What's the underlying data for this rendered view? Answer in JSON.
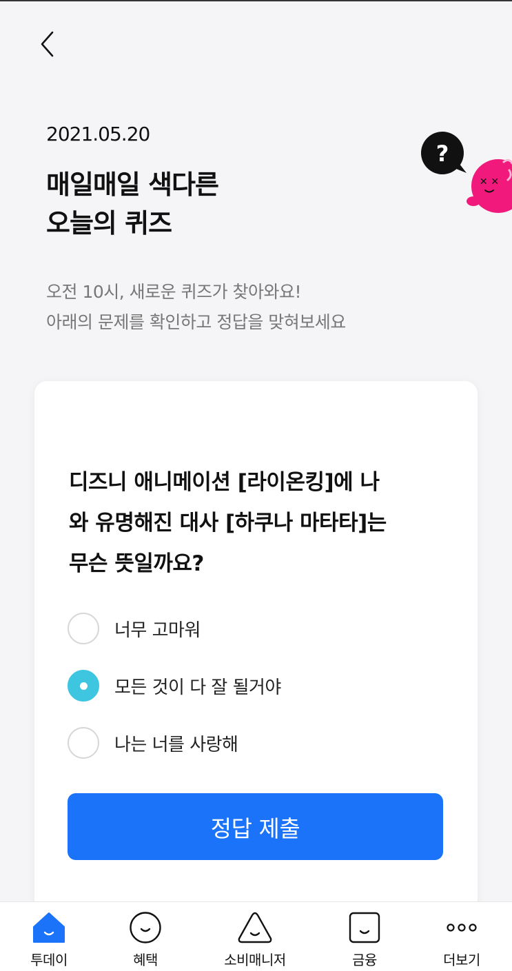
{
  "header": {
    "back_icon": "chevron-left-icon"
  },
  "hero": {
    "date": "2021.05.20",
    "title_line1": "매일매일 색다른",
    "title_line2": "오늘의 퀴즈",
    "subtitle_line1": "오전 10시, 새로운 퀴즈가 찾아와요!",
    "subtitle_line2": "아래의 문제를 확인하고 정답을 맞혀보세요",
    "mascot_bubble_text": "?"
  },
  "quiz": {
    "question_line1": "디즈니 애니메이션 [라이온킹]에 나",
    "question_line2": "와 유명해진 대사 [하쿠나 마타타]는",
    "question_line3": "무슨 뜻일까요?",
    "options": [
      {
        "label": "너무 고마워",
        "selected": false
      },
      {
        "label": "모든 것이 다 잘 될거야",
        "selected": true
      },
      {
        "label": "나는 너를 사랑해",
        "selected": false
      }
    ],
    "submit_label": "정답 제출"
  },
  "tabbar": {
    "tabs": [
      {
        "label": "투데이",
        "icon": "home-icon",
        "active": true
      },
      {
        "label": "혜택",
        "icon": "smile-circle-icon",
        "active": false
      },
      {
        "label": "소비매니저",
        "icon": "smile-triangle-icon",
        "active": false
      },
      {
        "label": "금융",
        "icon": "smile-square-icon",
        "active": false
      },
      {
        "label": "더보기",
        "icon": "more-dots-icon",
        "active": false
      }
    ]
  },
  "colors": {
    "accent_blue": "#1a73f8",
    "radio_selected": "#3ec6e0",
    "mascot_pink": "#f2197c",
    "bubble_black": "#111111",
    "background": "#f5f5f7",
    "card": "#ffffff",
    "muted_text": "#777777"
  }
}
